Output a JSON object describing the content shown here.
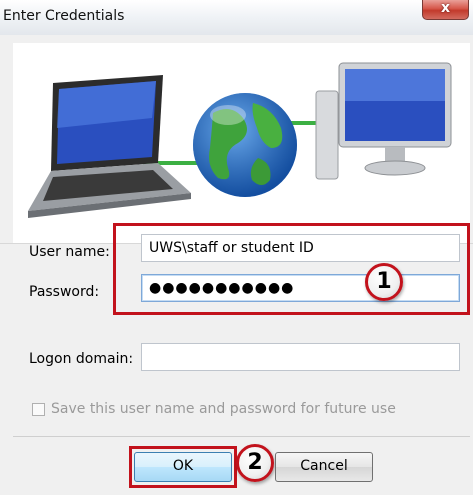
{
  "window": {
    "title": "Enter Credentials",
    "close_symbol": "x"
  },
  "form": {
    "username": {
      "label": "User name:",
      "value": "UWS\\staff or student ID"
    },
    "password": {
      "label": "Password:",
      "value": "●●●●●●●●●●●"
    },
    "domain": {
      "label": "Logon domain:",
      "value": ""
    },
    "save_checkbox": {
      "label": "Save this user name and password for future use",
      "checked": false,
      "enabled": false
    }
  },
  "callouts": {
    "step1": "1",
    "step2": "2"
  },
  "buttons": {
    "ok": "OK",
    "cancel": "Cancel"
  },
  "colors": {
    "highlight_red": "#c2121c",
    "ok_blue": "#bee6fd"
  },
  "icons": [
    "laptop-icon",
    "globe-icon",
    "desktop-computer-icon",
    "close-icon"
  ]
}
